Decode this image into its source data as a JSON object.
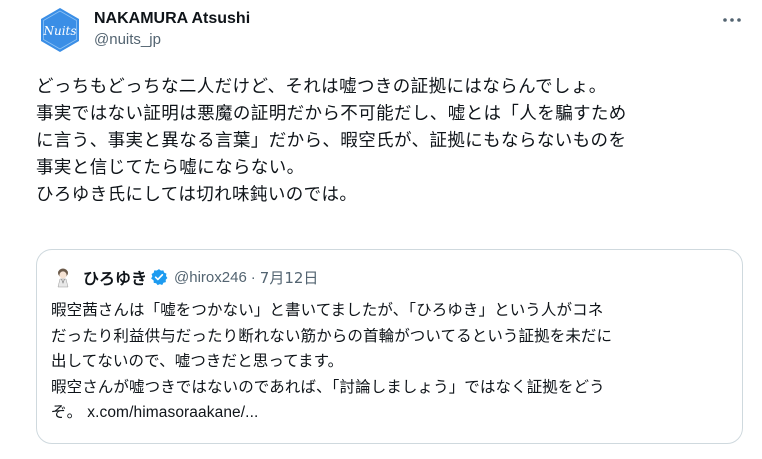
{
  "author": {
    "display_name": "NAKAMURA Atsushi",
    "handle": "@nuits_jp",
    "avatar_text": "Nuits"
  },
  "tweet": {
    "lines": [
      "どっちもどっちな二人だけど、それは嘘つきの証拠にはならんでしょ。",
      "事実ではない証明は悪魔の証明だから不可能だし、嘘とは「人を騙すため",
      "に言う、事実と異なる言葉」だから、暇空氏が、証拠にもならないものを",
      "事実と信じてたら嘘にならない。",
      "ひろゆき氏にしては切れ味鈍いのでは。"
    ]
  },
  "quoted": {
    "display_name": "ひろゆき",
    "handle": "@hirox246",
    "separator": "·",
    "date": "7月12日",
    "lines": [
      "暇空茜さんは「嘘をつかない」と書いてましたが、「ひろゆき」という人がコネ",
      "だったり利益供与だったり断れない筋からの首輪がついてるという証拠を未だに",
      "出してないので、嘘つきだと思ってます。",
      "暇空さんが嘘つきではないのであれば、「討論しましょう」ではなく証拠をどう"
    ],
    "last_line_prefix": "ぞ。 ",
    "link": "x.com/himasoraakane/..."
  },
  "colors": {
    "avatar_bg": "#3a8ee6",
    "verified": "#1d9bf0",
    "secondary_text": "#536471",
    "border": "#cfd9de"
  },
  "icons": {
    "more": "more-horizontal-icon",
    "verified": "verified-badge-icon"
  }
}
